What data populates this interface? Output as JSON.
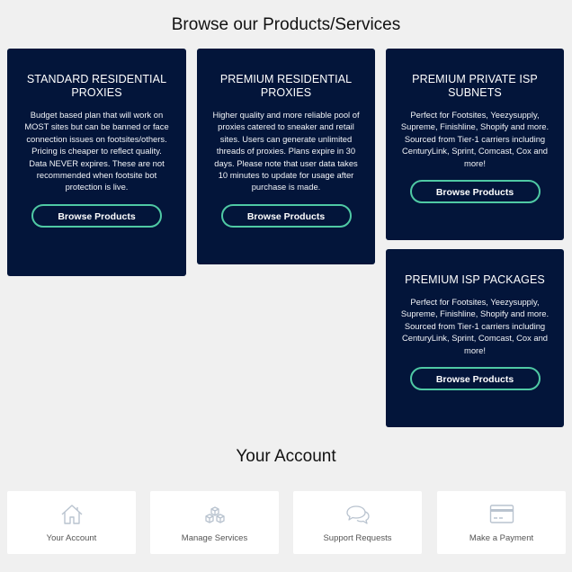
{
  "products_section": {
    "title": "Browse our Products/Services",
    "cards": [
      {
        "title": "STANDARD RESIDENTIAL PROXIES",
        "description": "Budget based plan that will work on MOST sites but can be banned or face connection issues on footsites/others. Pricing is cheaper to reflect quality. Data NEVER expires. These are not recommended when footsite bot protection is live.",
        "button_label": "Browse Products"
      },
      {
        "title": "PREMIUM RESIDENTIAL PROXIES",
        "description": "Higher quality and more reliable pool of proxies catered to sneaker and retail sites. Users can generate unlimited threads of proxies. Plans expire in 30 days. Please note that user data takes 10 minutes to update for usage after purchase is made.",
        "button_label": "Browse Products"
      },
      {
        "title": "PREMIUM PRIVATE ISP SUBNETS",
        "description": "Perfect for Footsites, Yeezysupply, Supreme, Finishline, Shopify and more. Sourced from Tier-1 carriers including CenturyLink, Sprint, Comcast, Cox and more!",
        "button_label": "Browse Products"
      },
      {
        "title": "PREMIUM ISP PACKAGES",
        "description": "Perfect for Footsites, Yeezysupply, Supreme, Finishline, Shopify and more. Sourced from Tier-1 carriers including CenturyLink, Sprint, Comcast, Cox and more!",
        "button_label": "Browse Products"
      }
    ]
  },
  "account_section": {
    "title": "Your Account",
    "tiles": [
      {
        "label": "Your Account",
        "icon": "home-icon"
      },
      {
        "label": "Manage Services",
        "icon": "cubes-icon"
      },
      {
        "label": "Support Requests",
        "icon": "chat-bubbles-icon"
      },
      {
        "label": "Make a Payment",
        "icon": "credit-card-icon"
      }
    ]
  },
  "colors": {
    "card_background": "#03153a",
    "button_border": "#4fc9a4",
    "page_background": "#f0f0f0",
    "icon_color": "#b9c3cf"
  }
}
